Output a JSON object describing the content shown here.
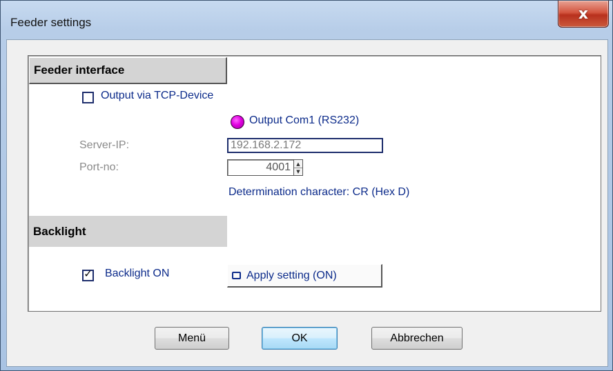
{
  "window": {
    "title": "Feeder settings",
    "close_glyph": "x"
  },
  "feeder_interface": {
    "header": "Feeder interface",
    "tcp_checkbox_label": "Output via TCP-Device",
    "tcp_checked": false,
    "com_radio_label": "Output Com1 (RS232)",
    "server_ip_label": "Server-IP:",
    "server_ip_value": "192.168.2.172",
    "port_label": "Port-no:",
    "port_value": "4001",
    "determination_text": "Determination character: CR (Hex D)"
  },
  "backlight": {
    "header": "Backlight",
    "checkbox_label": "Backlight ON",
    "checked": true,
    "check_glyph": "✓",
    "apply_button": "Apply setting (ON)"
  },
  "buttons": {
    "menu": "Menü",
    "ok": "OK",
    "cancel": "Abbrechen"
  },
  "colors": {
    "label_blue": "#0b2a8a",
    "radio_magenta": "#e000e0",
    "close_red": "#c8412b"
  }
}
